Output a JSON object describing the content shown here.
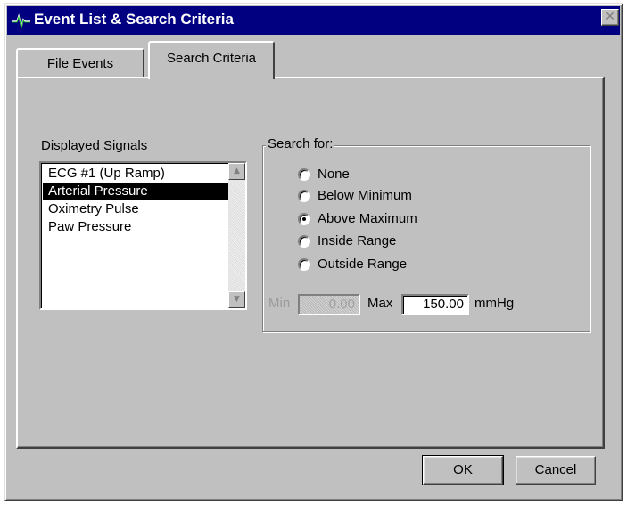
{
  "window": {
    "title": "Event List & Search Criteria",
    "close_glyph": "✕"
  },
  "tabs": [
    {
      "label": "File Events",
      "active": false
    },
    {
      "label": "Search Criteria",
      "active": true
    }
  ],
  "displayed_signals": {
    "label": "Displayed Signals",
    "items": [
      {
        "label": "ECG #1 (Up Ramp)",
        "selected": false
      },
      {
        "label": "Arterial Pressure",
        "selected": true
      },
      {
        "label": "Oximetry Pulse",
        "selected": false
      },
      {
        "label": "Paw Pressure",
        "selected": false
      }
    ],
    "scroll_up_glyph": "▲",
    "scroll_down_glyph": "▼"
  },
  "search_for": {
    "legend": "Search for:",
    "options": [
      {
        "label": "None",
        "checked": false
      },
      {
        "label": "Below Minimum",
        "checked": false
      },
      {
        "label": "Above Maximum",
        "checked": true
      },
      {
        "label": "Inside Range",
        "checked": false
      },
      {
        "label": "Outside Range",
        "checked": false
      }
    ],
    "min_label": "Min",
    "min_value": "0.00",
    "min_enabled": false,
    "max_label": "Max",
    "max_value": "150.00",
    "unit": "mmHg"
  },
  "buttons": {
    "ok": "OK",
    "cancel": "Cancel"
  },
  "colors": {
    "title_bar": "#000080",
    "face": "#c0c0c0",
    "selection": "#000000"
  },
  "icons": {
    "app": "waveform-icon",
    "close": "close-icon",
    "scroll_up": "scroll-up-arrow-icon",
    "scroll_down": "scroll-down-arrow-icon"
  }
}
